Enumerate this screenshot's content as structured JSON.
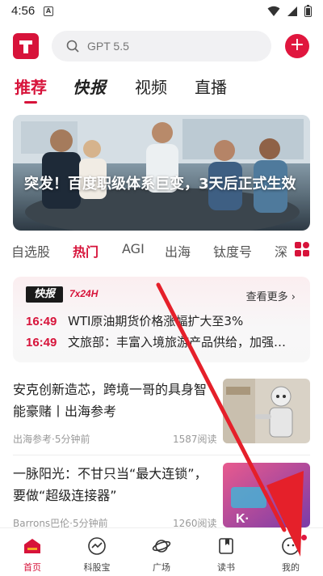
{
  "status_bar": {
    "time": "4:56",
    "notification_letter": "A"
  },
  "search": {
    "placeholder": "GPT 5.5"
  },
  "tabs": [
    {
      "label": "推荐",
      "active": true
    },
    {
      "label": "快报",
      "active": false
    },
    {
      "label": "视频",
      "active": false
    },
    {
      "label": "直播",
      "active": false
    }
  ],
  "banner": {
    "caption": "突发！百度职级体系巨变，3天后正式生效"
  },
  "channels": [
    {
      "label": "自选股",
      "active": false
    },
    {
      "label": "热门",
      "active": true
    },
    {
      "label": "AGI",
      "active": false
    },
    {
      "label": "出海",
      "active": false
    },
    {
      "label": "钛度号",
      "active": false
    },
    {
      "label": "深",
      "active": false
    }
  ],
  "flash": {
    "badge": "快报",
    "subtitle": "7x24H",
    "see_more": "查看更多 ›",
    "items": [
      {
        "time": "16:49",
        "text": "WTI原油期货价格涨幅扩大至3%"
      },
      {
        "time": "16:49",
        "text": "文旅部：丰富入境旅游产品供给，加强…"
      }
    ]
  },
  "news": [
    {
      "title": "安克创新造芯，跨境一哥的具身智能豪赌丨出海参考",
      "meta": "出海参考·5分钟前",
      "reads": "1587阅读"
    },
    {
      "title": "一脉阳光：不甘只当“最大连锁”，要做“超级连接器”",
      "meta": "Barrons巴伦·5分钟前",
      "reads": "1260阅读"
    }
  ],
  "bottom_nav": [
    {
      "label": "首页",
      "icon": "home-icon",
      "active": true
    },
    {
      "label": "科股宝",
      "icon": "trend-icon",
      "active": false
    },
    {
      "label": "广场",
      "icon": "planet-icon",
      "active": false
    },
    {
      "label": "读书",
      "icon": "book-icon",
      "active": false
    },
    {
      "label": "我的",
      "icon": "profile-icon",
      "active": false
    }
  ],
  "colors": {
    "accent": "#d7133a",
    "annotation_arrow": "#e5202a"
  }
}
